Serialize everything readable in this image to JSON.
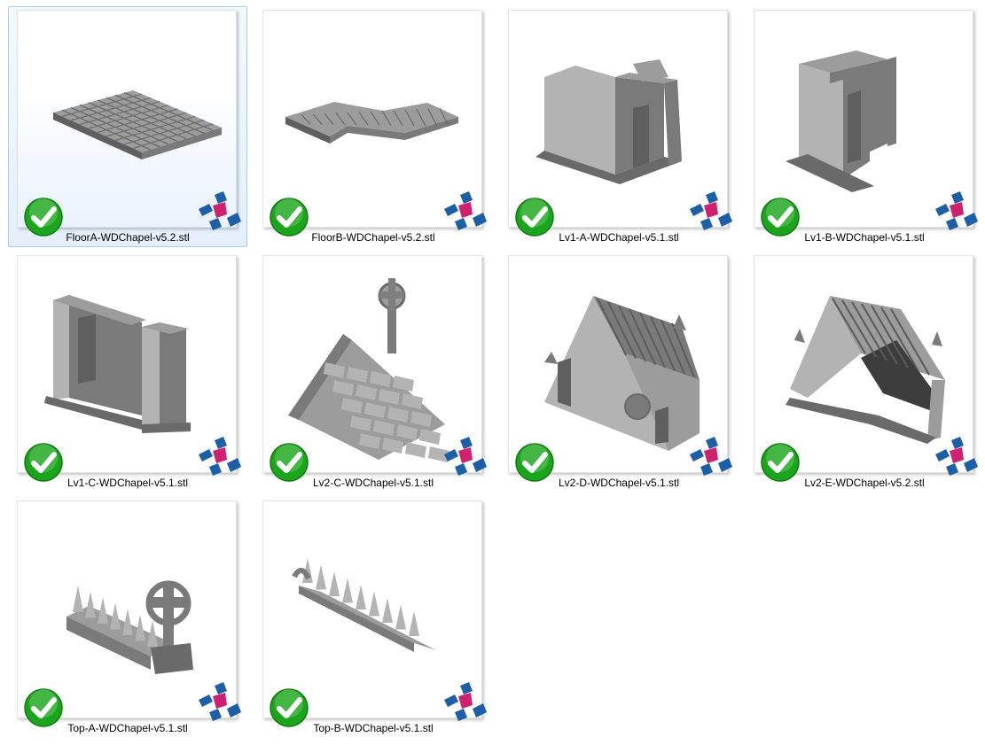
{
  "files": [
    {
      "name": "FloorA-WDChapel-v5.2.stl",
      "model": "floor-tile-grid",
      "status": "check-icon",
      "selected": true
    },
    {
      "name": "FloorB-WDChapel-v5.2.stl",
      "model": "floor-l-shape",
      "status": "check-icon"
    },
    {
      "name": "Lv1-A-WDChapel-v5.1.stl",
      "model": "wall-u-doorway",
      "status": "check-icon"
    },
    {
      "name": "Lv1-B-WDChapel-v5.1.stl",
      "model": "wall-arch-pair",
      "status": "check-icon"
    },
    {
      "name": "Lv1-C-WDChapel-v5.1.stl",
      "model": "wall-corner",
      "status": "check-icon"
    },
    {
      "name": "Lv2-C-WDChapel-v5.1.stl",
      "model": "roof-cross",
      "status": "check-icon"
    },
    {
      "name": "Lv2-D-WDChapel-v5.1.stl",
      "model": "chapel-gothic-front",
      "status": "check-icon"
    },
    {
      "name": "Lv2-E-WDChapel-v5.2.stl",
      "model": "chapel-roof-open",
      "status": "check-icon"
    },
    {
      "name": "Top-A-WDChapel-v5.1.stl",
      "model": "spike-ridge-cross",
      "status": "check-icon"
    },
    {
      "name": "Top-B-WDChapel-v5.1.stl",
      "model": "spike-ridge",
      "status": "check-icon"
    }
  ],
  "colors": {
    "selection_fill": "#e4effb",
    "selection_border": "#a9cdf0",
    "check_green": "#1aa61a",
    "brand_blue": "#1b5fa8",
    "brand_magenta": "#d0216e",
    "model_gray": "#8a8a8a"
  }
}
